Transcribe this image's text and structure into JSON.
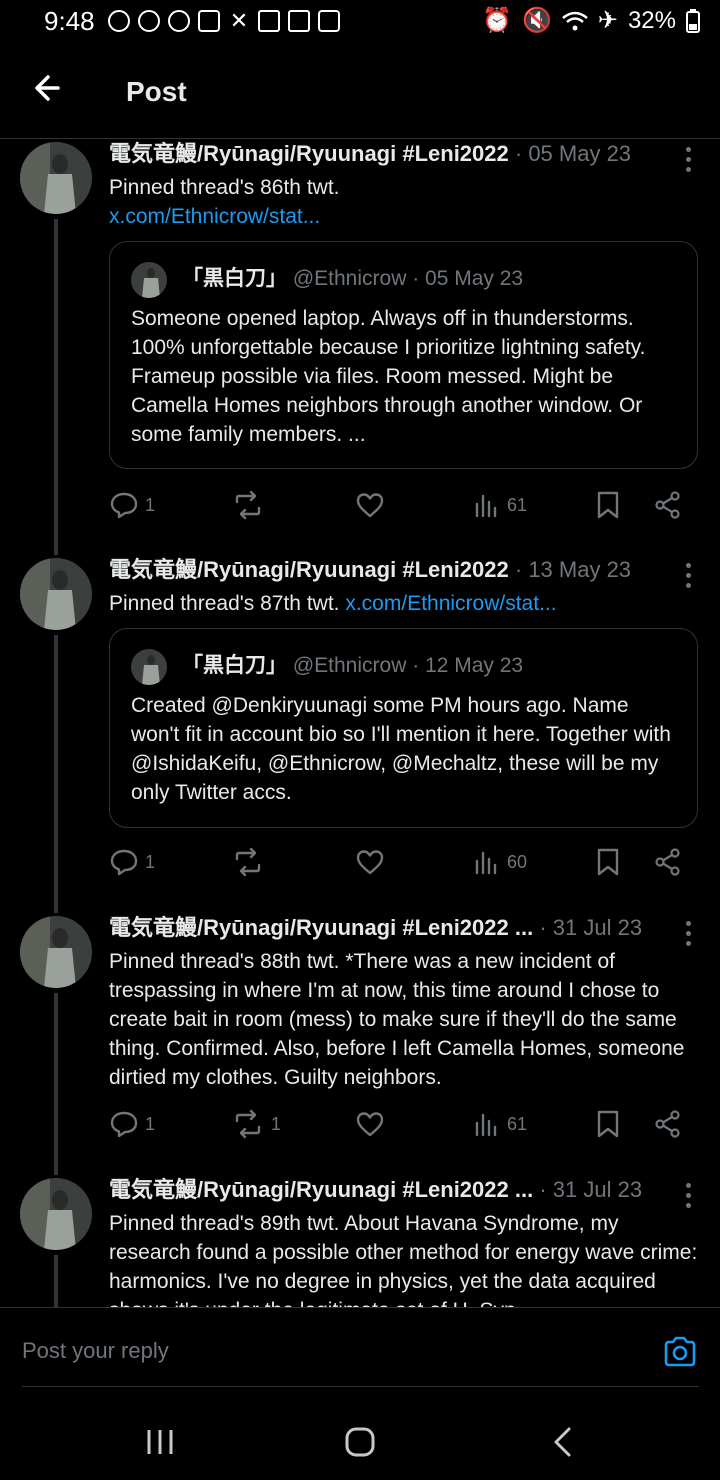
{
  "status_bar": {
    "time": "9:48",
    "battery": "32%"
  },
  "header": {
    "title": "Post"
  },
  "posts": [
    {
      "author": "電気竜鰻/Ryūnagi/Ryuunagi #Leni2022",
      "date": "· 05 May 23",
      "text": "Pinned thread's 86th twt.",
      "link": "x.com/Ethnicrow/stat...",
      "quote": {
        "name": "「黒白刀」",
        "handle": "@Ethnicrow",
        "date": "· 05 May 23",
        "text": "Someone opened laptop. Always off in thunderstorms. 100% unforgettable because I prioritize lightning safety. Frameup possible via files. Room messed. Might be Camella Homes neighbors through another window. Or some family members. ..."
      },
      "replies": "1",
      "reposts": "",
      "views": "61"
    },
    {
      "author": "電気竜鰻/Ryūnagi/Ryuunagi #Leni2022",
      "date": "· 13 May 23",
      "text": "Pinned thread's 87th twt.",
      "link": "x.com/Ethnicrow/stat...",
      "quote": {
        "name": "「黒白刀」",
        "handle": "@Ethnicrow",
        "date": "· 12 May 23",
        "text": "Created @Denkiryuunagi some PM hours ago. Name won't fit in account bio so I'll mention it here. Together with @IshidaKeifu, @Ethnicrow, @Mechaltz, these will be my only Twitter accs."
      },
      "replies": "1",
      "reposts": "",
      "views": "60"
    },
    {
      "author": "電気竜鰻/Ryūnagi/Ryuunagi #Leni2022 ...",
      "date": "· 31 Jul 23",
      "text": "Pinned thread's 88th twt. *There was a new incident of trespassing in where I'm at now, this time around I chose to create bait in room (mess) to make sure if they'll do the same thing. Confirmed. Also, before I left Camella Homes, someone dirtied my clothes. Guilty neighbors.",
      "replies": "1",
      "reposts": "1",
      "views": "61"
    },
    {
      "author": "電気竜鰻/Ryūnagi/Ryuunagi #Leni2022 ...",
      "date": "· 31 Jul 23",
      "text": "Pinned thread's 89th twt. About Havana Syndrome, my research found a possible other method for energy wave crime: harmonics. I've no degree in physics, yet the data acquired shows it's under the legitimate set of H. Syn..."
    }
  ],
  "reply_bar": {
    "placeholder": "Post your reply"
  },
  "colors": {
    "background": "#000000",
    "text": "#e7e9ea",
    "muted": "#71767b",
    "link": "#1d9bf0",
    "border": "#2f3336"
  }
}
